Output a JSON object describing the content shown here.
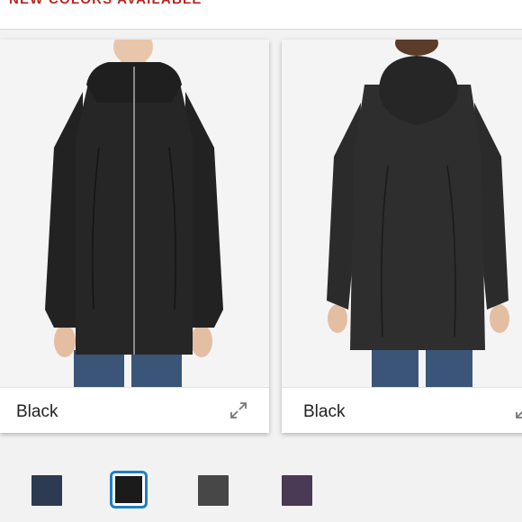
{
  "banner": {
    "text": "NEW COLORS AVAILABLE"
  },
  "cards": [
    {
      "caption": "Black",
      "view": "front",
      "expand_icon": "expand-arrows-icon"
    },
    {
      "caption": "Black",
      "view": "back",
      "expand_icon": "expand-arrows-icon"
    }
  ],
  "swatches": [
    {
      "color_name": "navy-heather",
      "color": "#2c3a52",
      "selected": false
    },
    {
      "color_name": "black",
      "color": "#1b1b1b",
      "selected": true
    },
    {
      "color_name": "charcoal-heather",
      "color": "#474747",
      "selected": false
    },
    {
      "color_name": "plum-heather",
      "color": "#4a3a55",
      "selected": false
    }
  ],
  "colors": {
    "banner_text": "#b5281f",
    "selected_border": "#1f7fc2",
    "jacket": "#262626"
  }
}
